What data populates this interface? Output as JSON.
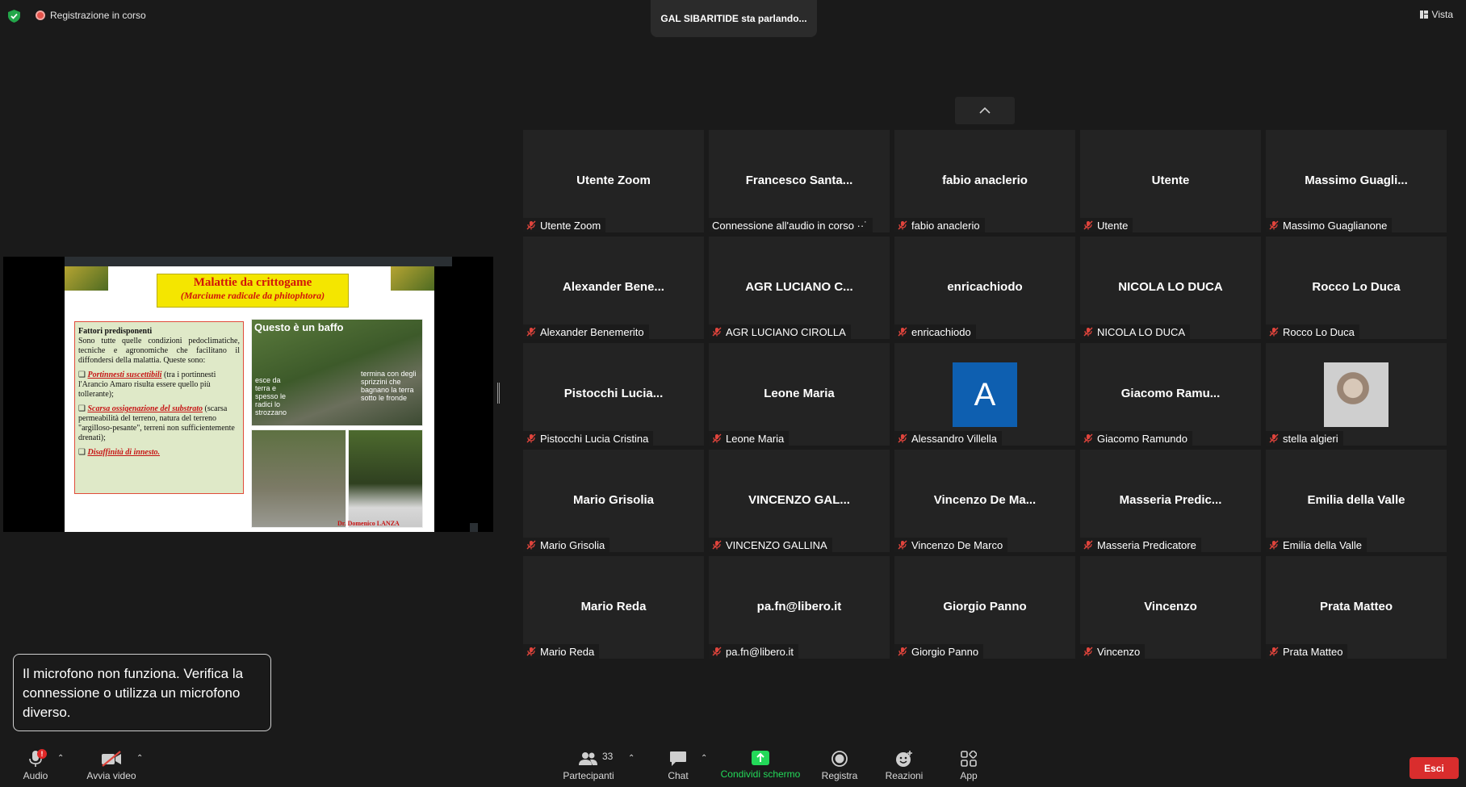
{
  "topbar": {
    "recording": "Registrazione in corso",
    "speaking": "GAL SIBARITIDE sta parlando...",
    "view": "Vista"
  },
  "slide": {
    "title": "Malattie da crittogame",
    "subtitle": "(Marciume radicale da phitophtora)",
    "box_heading": "Fattori predisponenti",
    "box_intro": "Sono tutte quelle condizioni pedoclimatiche, tecniche e agronomiche che facilitano il diffondersi della malattia. Queste sono:",
    "item1_red": "Portinnesti suscettibili",
    "item1_rest": "(tra i portinnesti l'Arancio Amaro risulta essere quello più tollerante);",
    "item2_red": "Scarsa ossigenazione del substrato",
    "item2_rest": "(scarsa permeabilità del terreno, natura del terreno \"argilloso-pesante\", terreni non sufficientemente drenati);",
    "item3_red": "Disaffinità di innesto.",
    "photo_label": "Questo è un baffo",
    "photo_note_left": "esce da terra e spesso le radici lo strozzano",
    "photo_note_right": "termina con degli sprizzini che bagnano la terra sotto le fronde",
    "author": "Dr. Domenico LANZA"
  },
  "participants": [
    {
      "name": "Utente Zoom",
      "label": "Utente Zoom",
      "muted": true
    },
    {
      "name": "Francesco  Santa...",
      "label": "Connessione all'audio in corso ··˙",
      "muted": false
    },
    {
      "name": "fabio anaclerio",
      "label": "fabio anaclerio",
      "muted": true
    },
    {
      "name": "Utente",
      "label": "Utente",
      "muted": true
    },
    {
      "name": "Massimo  Guagli...",
      "label": "Massimo Guaglianone",
      "muted": true
    },
    {
      "name": "Alexander  Bene...",
      "label": "Alexander Benemerito",
      "muted": true
    },
    {
      "name": "AGR LUCIANO C...",
      "label": "AGR LUCIANO CIROLLA",
      "muted": true
    },
    {
      "name": "enricachiodo",
      "label": "enricachiodo",
      "muted": true
    },
    {
      "name": "NICOLA LO DUCA",
      "label": "NICOLA LO DUCA",
      "muted": true
    },
    {
      "name": "Rocco Lo Duca",
      "label": "Rocco Lo Duca",
      "muted": true
    },
    {
      "name": "Pistocchi  Lucia...",
      "label": "Pistocchi Lucia Cristina",
      "muted": true
    },
    {
      "name": "Leone Maria",
      "label": "Leone Maria",
      "muted": true
    },
    {
      "name": "",
      "label": "Alessandro Villella",
      "muted": true,
      "avatar_letter": "A"
    },
    {
      "name": "Giacomo  Ramu...",
      "label": "Giacomo Ramundo",
      "muted": true
    },
    {
      "name": "",
      "label": "stella algieri",
      "muted": true,
      "avatar_photo": true
    },
    {
      "name": "Mario Grisolia",
      "label": "Mario Grisolia",
      "muted": true
    },
    {
      "name": "VINCENZO  GAL...",
      "label": "VINCENZO GALLINA",
      "muted": true
    },
    {
      "name": "Vincenzo  De  Ma...",
      "label": "Vincenzo De Marco",
      "muted": true
    },
    {
      "name": "Masseria  Predic...",
      "label": "Masseria Predicatore",
      "muted": true
    },
    {
      "name": "Emilia della Valle",
      "label": "Emilia della Valle",
      "muted": true
    },
    {
      "name": "Mario Reda",
      "label": "Mario Reda",
      "muted": true
    },
    {
      "name": "pa.fn@libero.it",
      "label": "pa.fn@libero.it",
      "muted": true
    },
    {
      "name": "Giorgio Panno",
      "label": "Giorgio Panno",
      "muted": true
    },
    {
      "name": "Vincenzo",
      "label": "Vincenzo",
      "muted": true
    },
    {
      "name": "Prata Matteo",
      "label": "Prata Matteo",
      "muted": true
    }
  ],
  "toast": "Il microfono non funziona. Verifica la connessione o utilizza un microfono diverso.",
  "toolbar": {
    "audio": "Audio",
    "video": "Avvia video",
    "participants": "Partecipanti",
    "participants_count": "33",
    "chat": "Chat",
    "share": "Condividi schermo",
    "record": "Registra",
    "reactions": "Reazioni",
    "apps": "App",
    "leave": "Esci",
    "audio_badge": "!"
  },
  "colors": {
    "share_green": "#23d959",
    "leave_red": "#d92d2d",
    "muted_red": "#e0443c"
  }
}
